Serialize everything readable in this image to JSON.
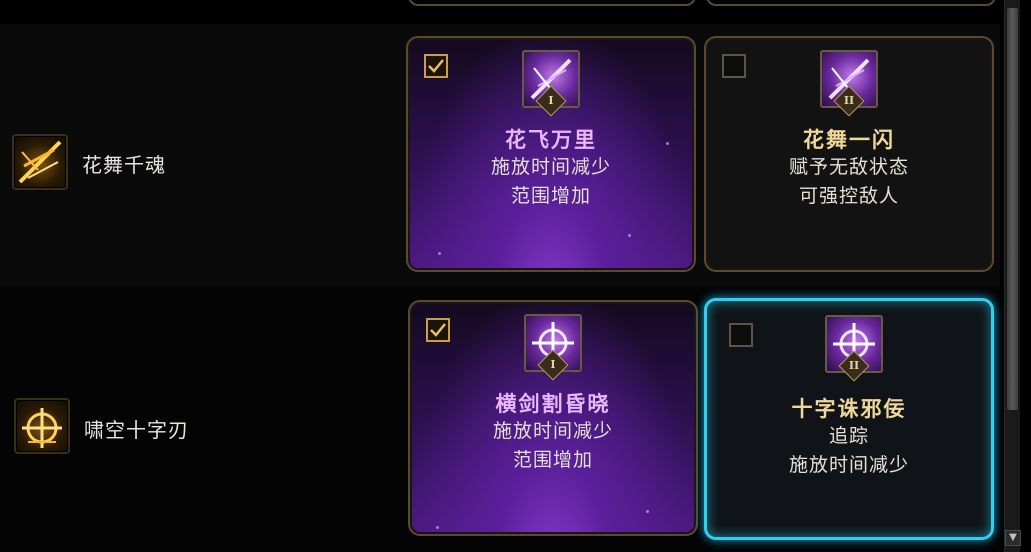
{
  "skills": [
    {
      "name": "花舞千魂",
      "icon": "blossom-slash-icon",
      "runes": [
        {
          "selected": true,
          "tier": "I",
          "title": "花飞万里",
          "line1": "施放时间减少",
          "line2": "范围增加"
        },
        {
          "selected": false,
          "tier": "II",
          "title": "花舞一闪",
          "line1": "赋予无敌状态",
          "line2": "可强控敌人"
        }
      ]
    },
    {
      "name": "啸空十字刃",
      "icon": "cross-blade-icon",
      "runes": [
        {
          "selected": true,
          "tier": "I",
          "title": "横剑割昏晓",
          "line1": "施放时间减少",
          "line2": "范围增加"
        },
        {
          "selected": false,
          "tier": "II",
          "title": "十字诛邪佞",
          "line1": "追踪",
          "line2": "施放时间减少"
        }
      ]
    }
  ],
  "colors": {
    "selected_card": "#4a1a80",
    "hover_border": "#2fd0f0",
    "card_border": "#5a4a32",
    "selected_title": "#e9b6ff",
    "unselected_title": "#f0d89a"
  }
}
